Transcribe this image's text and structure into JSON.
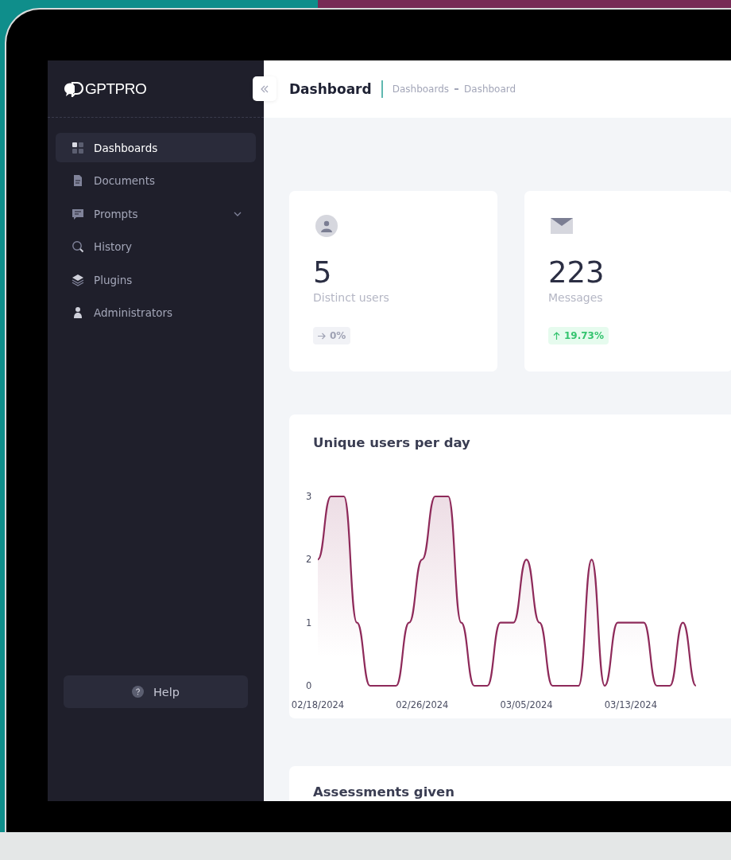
{
  "brand": {
    "name": "GPTPRO"
  },
  "sidebar": {
    "items": [
      {
        "label": "Dashboards",
        "selected": true,
        "expandable": false
      },
      {
        "label": "Documents",
        "selected": false,
        "expandable": false
      },
      {
        "label": "Prompts",
        "selected": false,
        "expandable": true
      },
      {
        "label": "History",
        "selected": false,
        "expandable": false
      },
      {
        "label": "Plugins",
        "selected": false,
        "expandable": false
      },
      {
        "label": "Administrators",
        "selected": false,
        "expandable": false
      }
    ],
    "help": "Help"
  },
  "header": {
    "title": "Dashboard",
    "breadcrumb": [
      "Dashboards",
      "Dashboard"
    ]
  },
  "stats": [
    {
      "value": "5",
      "label": "Distinct users",
      "kind": "flat",
      "change": "0%"
    },
    {
      "value": "223",
      "label": "Messages",
      "kind": "up",
      "change": "19.73%"
    }
  ],
  "chart_card": {
    "title": "Unique users per day",
    "chart_data": {
      "type": "area",
      "categories": [
        "02/18/2024",
        null,
        null,
        null,
        null,
        null,
        null,
        null,
        "02/26/2024",
        null,
        null,
        null,
        null,
        null,
        null,
        null,
        "03/05/2024",
        null,
        null,
        null,
        null,
        null,
        null,
        null,
        "03/13/2024",
        null,
        null,
        null,
        null,
        null
      ],
      "series": [
        {
          "color": "#8e2a5a",
          "values": [
            2,
            3,
            3,
            1,
            0,
            0,
            0,
            1,
            2,
            3,
            3,
            1,
            0,
            0,
            1,
            1,
            2,
            1,
            0,
            0,
            0,
            2,
            0,
            1,
            1,
            1,
            0,
            0,
            1,
            0
          ]
        }
      ],
      "ylim": [
        0,
        3
      ],
      "yticks": [
        0,
        1,
        2,
        3
      ]
    }
  },
  "next_card": {
    "title": "Assessments given"
  }
}
